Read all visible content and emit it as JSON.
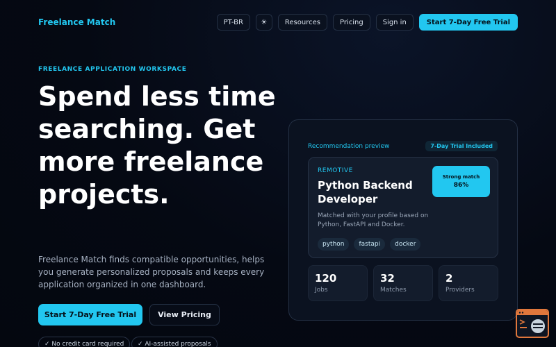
{
  "nav": {
    "brand": "Freelance Match",
    "language": "PT-BR",
    "theme_icon": "☀",
    "resources": "Resources",
    "pricing": "Pricing",
    "sign_in": "Sign in",
    "cta": "Start 7-Day Free Trial"
  },
  "hero": {
    "eyebrow": "FREELANCE APPLICATION WORKSPACE",
    "title": "Spend less time searching. Get more freelance projects.",
    "description": "Freelance Match finds compatible opportunities, helps you generate personalized proposals and keeps every application organized in one dashboard.",
    "primary_cta": "Start 7-Day Free Trial",
    "secondary_cta": "View Pricing",
    "pills": [
      "✓ No credit card required",
      "✓ AI-assisted proposals"
    ]
  },
  "preview": {
    "label": "Recommendation preview",
    "badge": "7-Day Trial Included",
    "job": {
      "company": "REMOTIVE",
      "title": "Python Backend Developer",
      "description": "Matched with your profile based on Python, FastAPI and Docker.",
      "match_label": "Strong match",
      "match_value": "86%",
      "tags": [
        "python",
        "fastapi",
        "docker"
      ]
    },
    "stats": [
      {
        "value": "120",
        "label": "Jobs"
      },
      {
        "value": "32",
        "label": "Matches"
      },
      {
        "value": "2",
        "label": "Providers"
      }
    ]
  },
  "colors": {
    "accent": "#22c7f0",
    "background": "#050913",
    "assistant_border": "#e0773c"
  },
  "icons": {
    "theme": "sun-icon",
    "assistant": "chat-assistant-icon"
  }
}
